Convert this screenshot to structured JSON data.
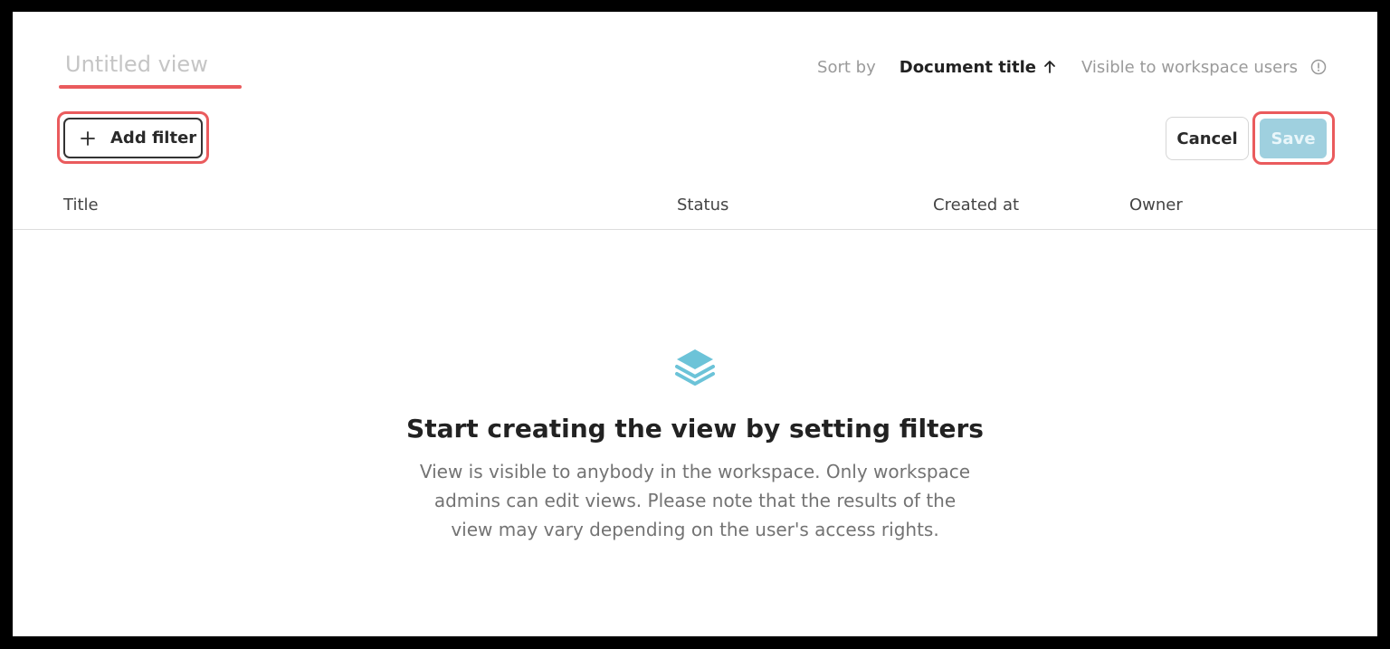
{
  "view": {
    "title_placeholder": "Untitled view"
  },
  "sort": {
    "label": "Sort by",
    "field": "Document title",
    "direction_icon": "arrow-up-icon"
  },
  "visibility": {
    "label": "Visible to workspace users",
    "icon": "info-icon"
  },
  "toolbar": {
    "add_filter_label": "Add filter",
    "add_filter_icon": "plus-icon",
    "cancel_label": "Cancel",
    "save_label": "Save",
    "save_enabled": false
  },
  "table": {
    "columns": [
      "Title",
      "Status",
      "Created at",
      "Owner"
    ],
    "rows": []
  },
  "empty_state": {
    "icon": "layers-icon",
    "heading": "Start creating the view by setting filters",
    "description": "View is visible to anybody in the workspace. Only workspace admins can edit views. Please note that the results of the view may vary depending on the user's access rights."
  },
  "colors": {
    "accent_highlight": "#ea5b5d",
    "save_button_disabled": "#9fd0df",
    "empty_icon": "#6cc3d8"
  }
}
